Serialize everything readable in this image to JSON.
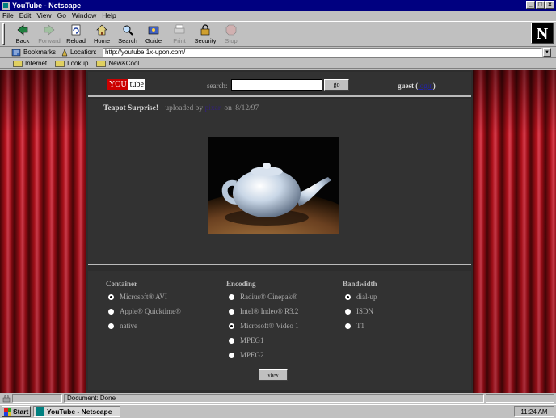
{
  "window": {
    "title": "YouTube - Netscape"
  },
  "menu": [
    "File",
    "Edit",
    "View",
    "Go",
    "Window",
    "Help"
  ],
  "toolbar": {
    "buttons": [
      {
        "label": "Back",
        "icon": "back-arrow-icon",
        "enabled": true
      },
      {
        "label": "Forward",
        "icon": "forward-arrow-icon",
        "enabled": false
      },
      {
        "label": "Reload",
        "icon": "reload-icon",
        "enabled": true
      },
      {
        "label": "Home",
        "icon": "home-icon",
        "enabled": true
      },
      {
        "label": "Search",
        "icon": "search-icon",
        "enabled": true
      },
      {
        "label": "Guide",
        "icon": "guide-icon",
        "enabled": true
      },
      {
        "label": "Print",
        "icon": "print-icon",
        "enabled": false
      },
      {
        "label": "Security",
        "icon": "lock-icon",
        "enabled": true
      },
      {
        "label": "Stop",
        "icon": "stop-icon",
        "enabled": false
      }
    ]
  },
  "location": {
    "bookmarks_label": "Bookmarks",
    "location_label": "Location:",
    "url": "http://youtube.1x-upon.com/"
  },
  "personal_toolbar": [
    "Internet",
    "Lookup",
    "New&Cool"
  ],
  "page": {
    "logo_you": "YOU",
    "logo_tube": "tube",
    "search_label": "search:",
    "search_value": "",
    "go_label": "go",
    "guest_label": "guest",
    "guest_paren_open": " (",
    "login_label": "login",
    "guest_paren_close": ")",
    "video": {
      "title": "Teapot Surprise!",
      "uploaded_by_label": "uploaded by",
      "uploader": "pixar",
      "date_prefix": "on",
      "date": "8/12/97"
    },
    "options": {
      "container": {
        "heading": "Container",
        "items": [
          {
            "label": "Microsoft® AVI",
            "selected": true
          },
          {
            "label": "Apple® Quicktime®",
            "selected": false
          },
          {
            "label": "native",
            "selected": false
          }
        ]
      },
      "encoding": {
        "heading": "Encoding",
        "items": [
          {
            "label": "Radius® Cinepak®",
            "selected": false
          },
          {
            "label": "Intel® Indeo® R3.2",
            "selected": false
          },
          {
            "label": "Microsoft® Video 1",
            "selected": true
          },
          {
            "label": "MPEG1",
            "selected": false
          },
          {
            "label": "MPEG2",
            "selected": false
          }
        ]
      },
      "bandwidth": {
        "heading": "Bandwidth",
        "items": [
          {
            "label": "dial-up",
            "selected": true
          },
          {
            "label": "ISDN",
            "selected": false
          },
          {
            "label": "T1",
            "selected": false
          }
        ]
      }
    },
    "view_label": "view"
  },
  "status": {
    "text": "Document: Done"
  },
  "taskbar": {
    "start_label": "Start",
    "task_label": "YouTube - Netscape",
    "clock": "11:24 AM"
  },
  "colors": {
    "window_title_bg": "#000080",
    "chrome": "#c0c0c0",
    "page_bg": "#2d2d2d",
    "curtain_red": "#b0101a",
    "logo_red": "#cc0000"
  }
}
